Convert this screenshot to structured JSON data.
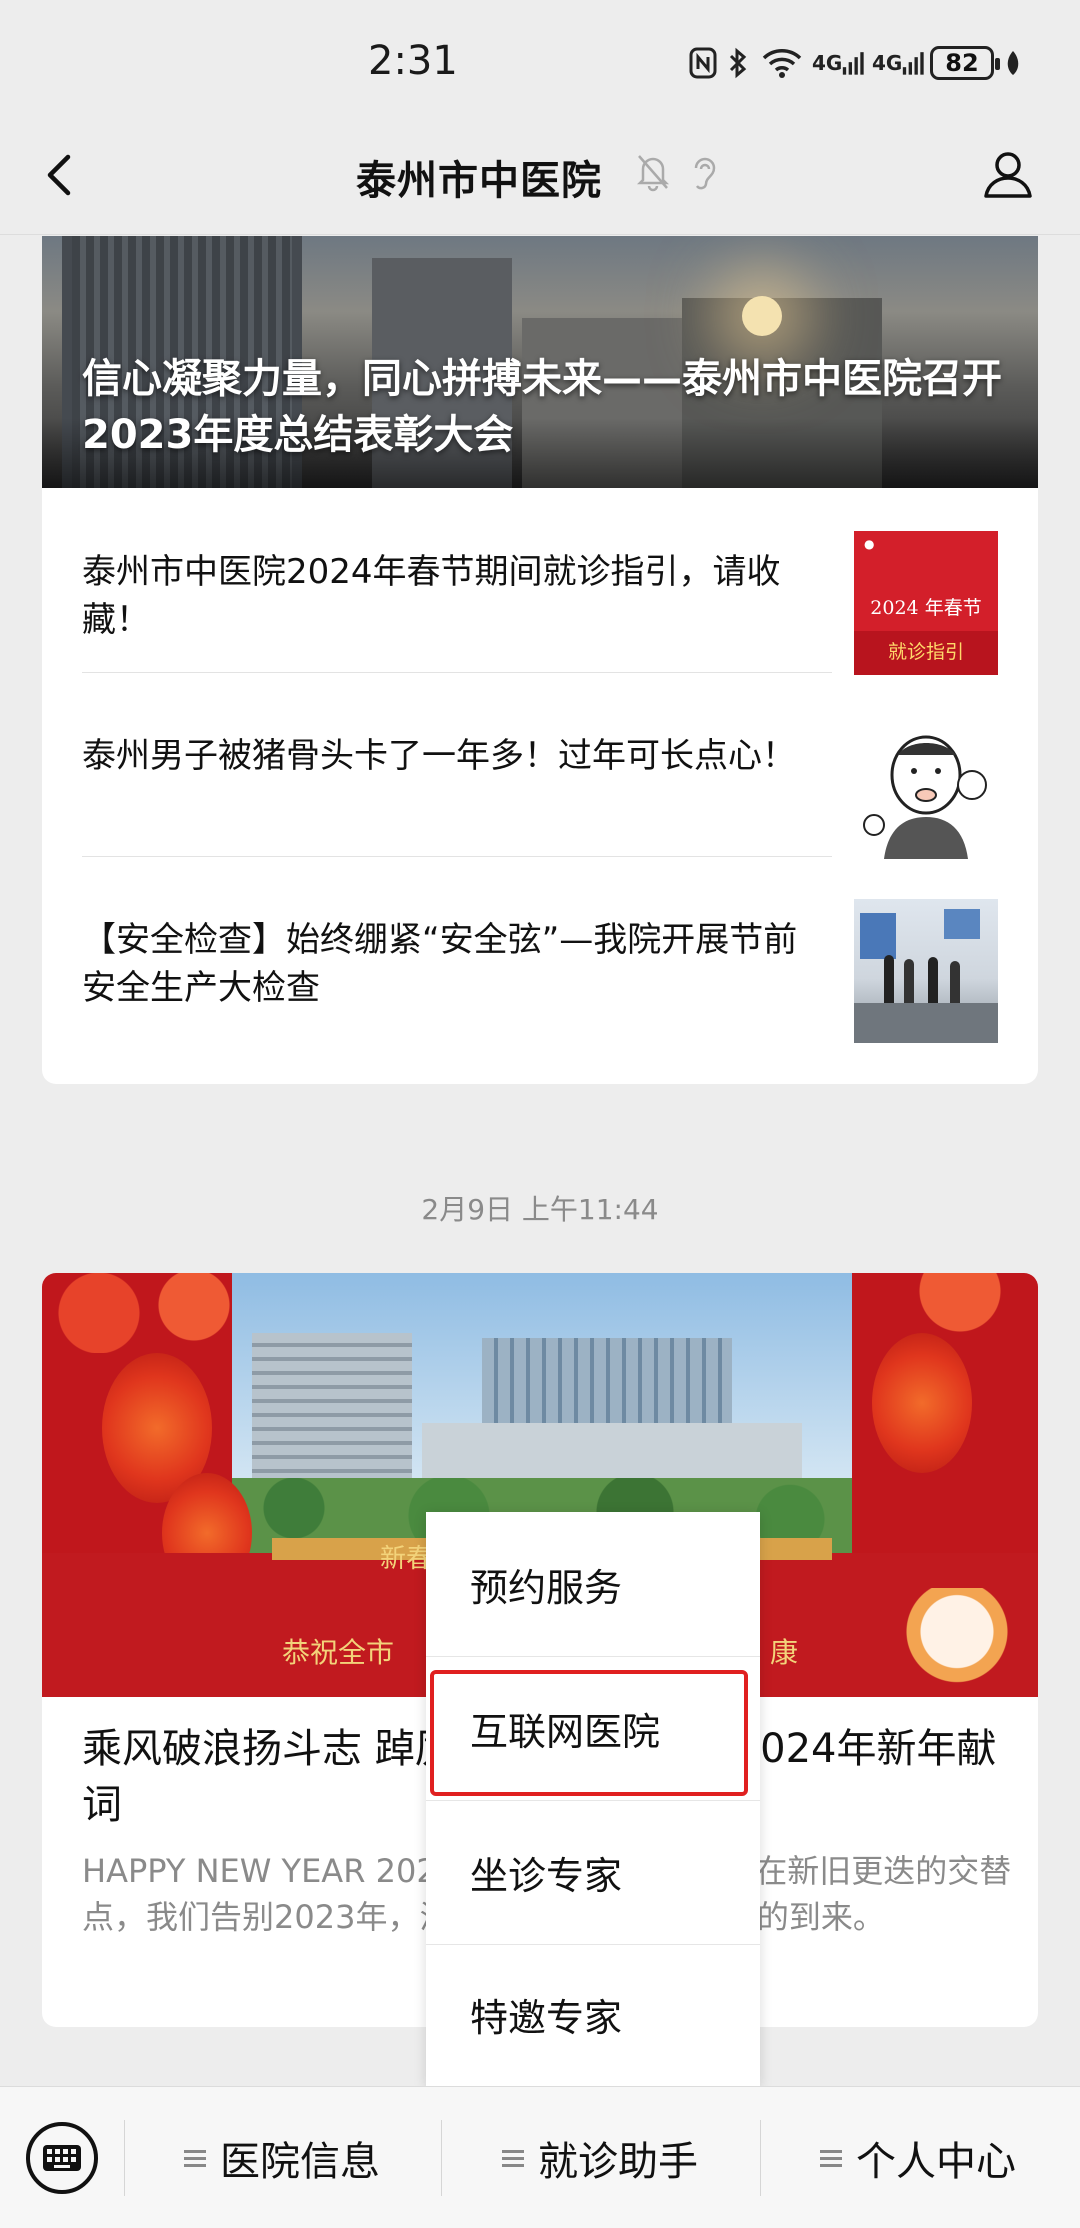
{
  "status_bar": {
    "time": "2:31",
    "signal_1": "4G",
    "signal_2": "4G",
    "battery": "82"
  },
  "nav": {
    "title": "泰州市中医院"
  },
  "card1": {
    "hero_title": "信心凝聚力量，同心拼搏未来——泰州市中医院召开2023年度总结表彰大会",
    "items": [
      {
        "title": "泰州市中医院2024年春节期间就诊指引，请收藏！",
        "thumb_text_1": "2024 年春节",
        "thumb_text_2": "就诊指引"
      },
      {
        "title": "泰州男子被猪骨头卡了一年多！过年可长点心！"
      },
      {
        "title": "【安全检查】始终绷紧“安全弦”—我院开展节前安全生产大检查"
      }
    ]
  },
  "timestamp": "2月9日 上午11:44",
  "card2": {
    "banner_left": "新春",
    "banner_bottom_left": "恭祝全市",
    "banner_bottom_right": "康",
    "title": "乘风破浪扬斗志 踔厉奋发启新程——2024年新年献词",
    "summary": "HAPPY NEW YEAR 2024 辞旧岁，开新元。站在新旧更迭的交替点，我们告别2023年，满怀期许地迎接2024年的到来。"
  },
  "menu": {
    "items": [
      "预约服务",
      "互联网医院",
      "坐诊专家",
      "特邀专家"
    ]
  },
  "bottom_bar": {
    "items": [
      "医院信息",
      "就诊助手",
      "个人中心"
    ]
  },
  "colors": {
    "background": "#ededed",
    "highlight": "#e02020",
    "banner_red": "#c0171c"
  }
}
